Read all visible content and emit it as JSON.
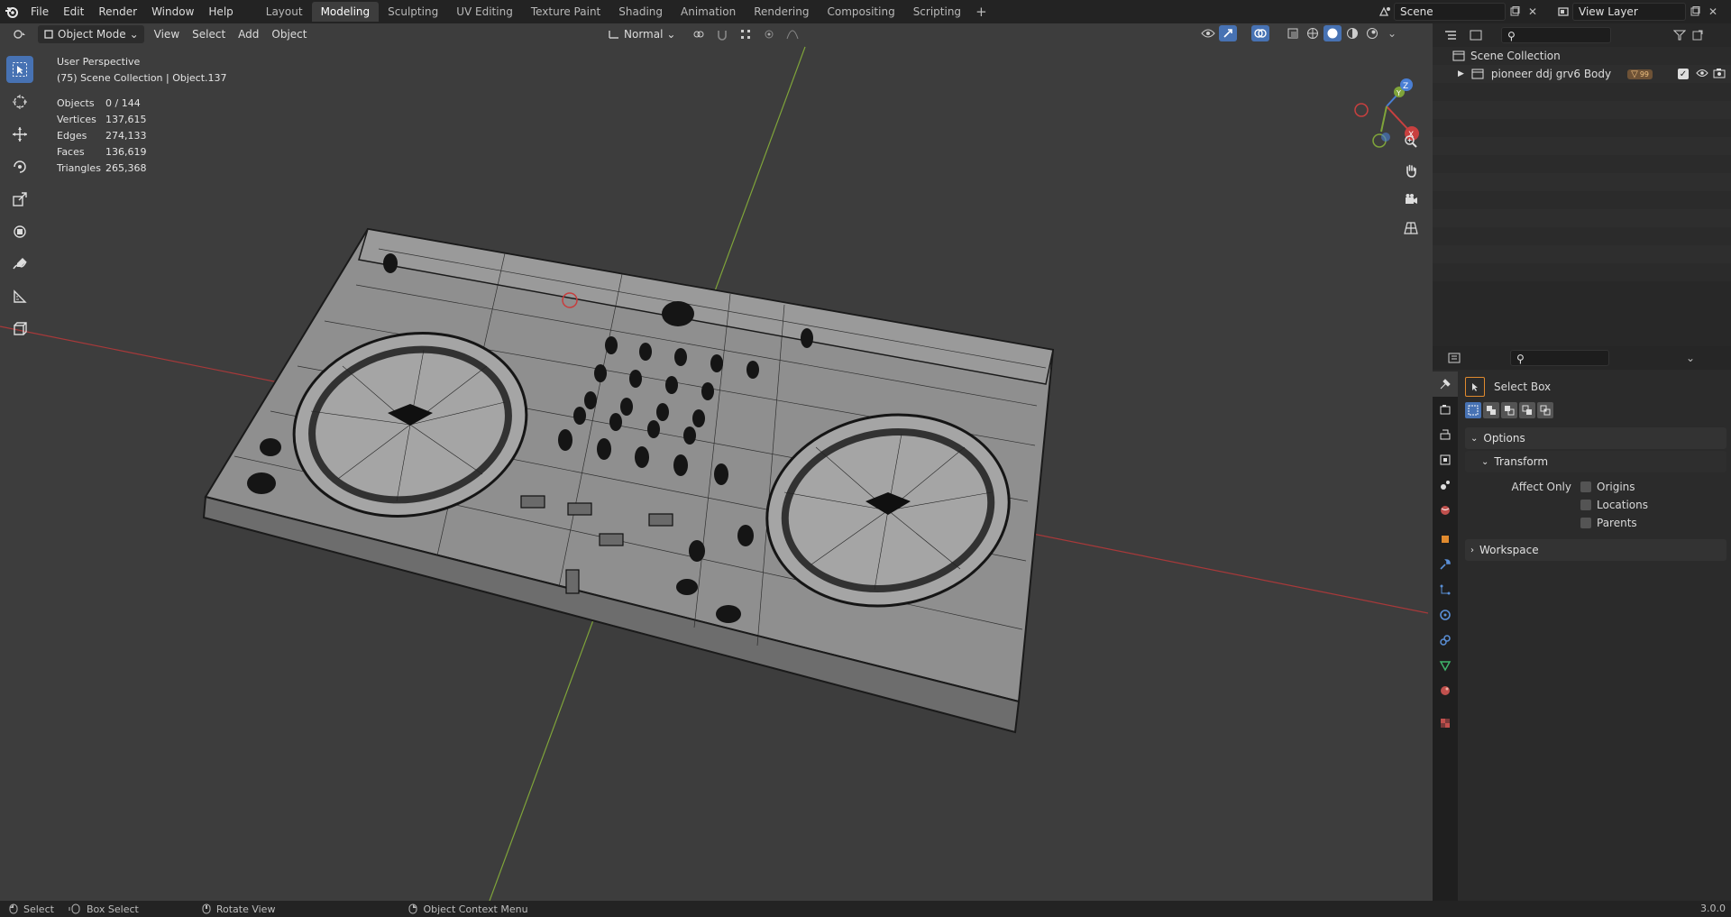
{
  "menu": [
    "File",
    "Edit",
    "Render",
    "Window",
    "Help"
  ],
  "workspaces": [
    {
      "label": "Layout",
      "active": false
    },
    {
      "label": "Modeling",
      "active": true
    },
    {
      "label": "Sculpting",
      "active": false
    },
    {
      "label": "UV Editing",
      "active": false
    },
    {
      "label": "Texture Paint",
      "active": false
    },
    {
      "label": "Shading",
      "active": false
    },
    {
      "label": "Animation",
      "active": false
    },
    {
      "label": "Rendering",
      "active": false
    },
    {
      "label": "Compositing",
      "active": false
    },
    {
      "label": "Scripting",
      "active": false
    }
  ],
  "scene": {
    "name": "Scene"
  },
  "view_layer": {
    "name": "View Layer"
  },
  "viewport_header": {
    "mode": "Object Mode",
    "menus": [
      "View",
      "Select",
      "Add",
      "Object"
    ],
    "orientation": "Normal"
  },
  "overlay": {
    "perspective": "User Perspective",
    "collection": "(75) Scene Collection | Object.137",
    "stats": [
      {
        "k": "Objects",
        "v": "0 / 144"
      },
      {
        "k": "Vertices",
        "v": "137,615"
      },
      {
        "k": "Edges",
        "v": "274,133"
      },
      {
        "k": "Faces",
        "v": "136,619"
      },
      {
        "k": "Triangles",
        "v": "265,368"
      }
    ]
  },
  "outliner": {
    "root": "Scene Collection",
    "items": [
      {
        "label": "pioneer ddj grv6 Body",
        "badge": "99"
      }
    ]
  },
  "properties": {
    "tool_name": "Select Box",
    "options_label": "Options",
    "transform_label": "Transform",
    "affect_only_label": "Affect Only",
    "checkboxes": [
      "Origins",
      "Locations",
      "Parents"
    ],
    "workspace_label": "Workspace"
  },
  "statusbar": {
    "items": [
      "Select",
      "Box Select",
      "Rotate View",
      "Object Context Menu"
    ],
    "version": "3.0.0"
  },
  "colors": {
    "accent": "#4772b3",
    "x_axis": "#c8403f",
    "y_axis": "#7fa43a",
    "z_axis": "#4a7fd4"
  }
}
